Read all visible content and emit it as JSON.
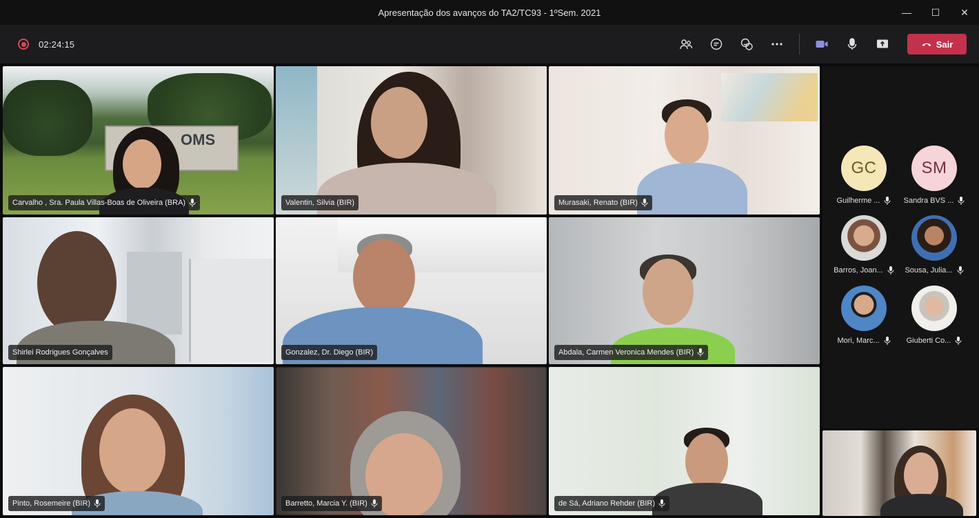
{
  "window": {
    "title": "Apresentação dos avanços do TA2/TC93 - 1ºSem. 2021",
    "minimize": "—",
    "maximize": "☐",
    "close": "✕"
  },
  "toolbar": {
    "timer": "02:24:15",
    "leave_label": "Sair",
    "leave_color": "#c4314b"
  },
  "tiles": [
    {
      "name": "Carvalho , Sra. Paula Villas-Boas de Oliveira (BRA)",
      "sign": "OMS"
    },
    {
      "name": "Valentin, Silvia (BIR)"
    },
    {
      "name": "Murasaki, Renato (BIR)"
    },
    {
      "name": "Shirlei Rodrigues Gonçalves"
    },
    {
      "name": "Gonzalez, Dr. Diego (BIR)"
    },
    {
      "name": "Abdala, Carmen Veronica Mendes (BIR)"
    },
    {
      "name": "Pinto, Rosemeire (BIR)"
    },
    {
      "name": "Barretto, Marcia Y. (BIR)"
    },
    {
      "name": "de Sá, Adriano Rehder (BIR)"
    }
  ],
  "panel": {
    "participants": [
      {
        "initials": "GC",
        "name": "Guilherme ...",
        "avatar_bg": "#f6e7b9",
        "avatar_fg": "#6b5a20"
      },
      {
        "initials": "SM",
        "name": "Sandra BVS ...",
        "avatar_bg": "#f6d5d8",
        "avatar_fg": "#7a2f3a"
      },
      {
        "name": "Barros, Joan..."
      },
      {
        "name": "Sousa, Julia..."
      },
      {
        "name": "Mori, Marc..."
      },
      {
        "name": "Giuberti Co..."
      }
    ]
  }
}
